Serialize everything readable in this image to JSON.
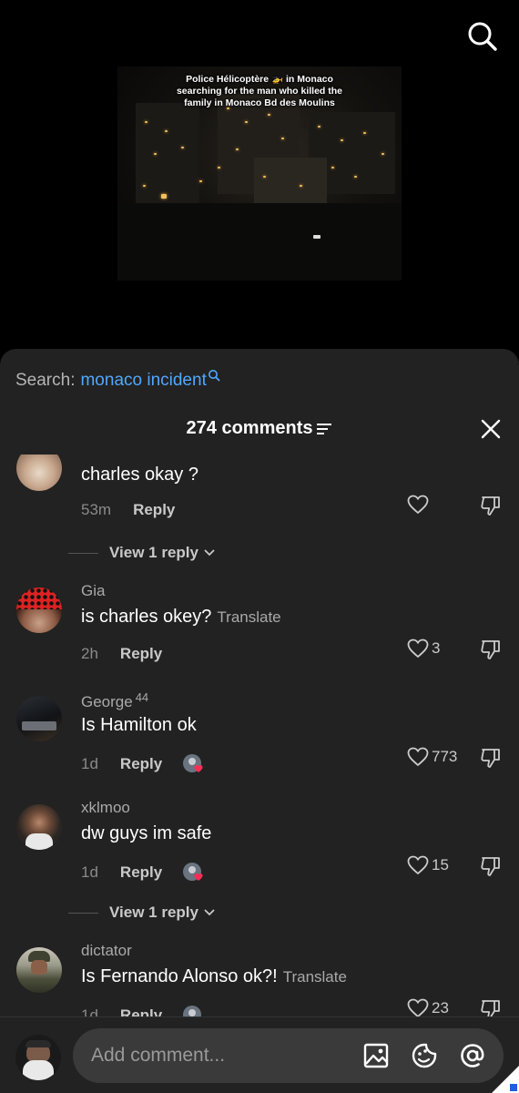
{
  "video": {
    "caption_line1": "Police Hélicoptère 🚁 in Monaco",
    "caption_line2": "searching for the man who killed the",
    "caption_line3": "family in Monaco Bd des Moulins"
  },
  "search": {
    "label": "Search:",
    "query": "monaco incident"
  },
  "header": {
    "title": "274 comments"
  },
  "comments": [
    {
      "username": "",
      "text": "charles okay ?",
      "time": "53m",
      "reply_label": "Reply",
      "likes": "",
      "view_replies": "View 1 reply"
    },
    {
      "username": "Gia",
      "text": "is charles okey?",
      "translate": "Translate",
      "time": "2h",
      "reply_label": "Reply",
      "likes": "3"
    },
    {
      "username": "George",
      "badge": "44",
      "text": "Is Hamilton ok",
      "time": "1d",
      "reply_label": "Reply",
      "likes": "773"
    },
    {
      "username": "xklmoo",
      "text": "dw guys im safe",
      "time": "1d",
      "reply_label": "Reply",
      "likes": "15",
      "view_replies": "View 1 reply"
    },
    {
      "username": "dictator",
      "text": "Is Fernando Alonso ok?!",
      "translate": "Translate",
      "time": "1d",
      "reply_label": "Reply",
      "likes": "23"
    }
  ],
  "input": {
    "placeholder": "Add comment..."
  },
  "colors": {
    "sheet_bg": "#222222",
    "link_blue": "#4fa8ff",
    "muted_text": "#a9a9a9",
    "creator_heart": "#fe2c55"
  }
}
